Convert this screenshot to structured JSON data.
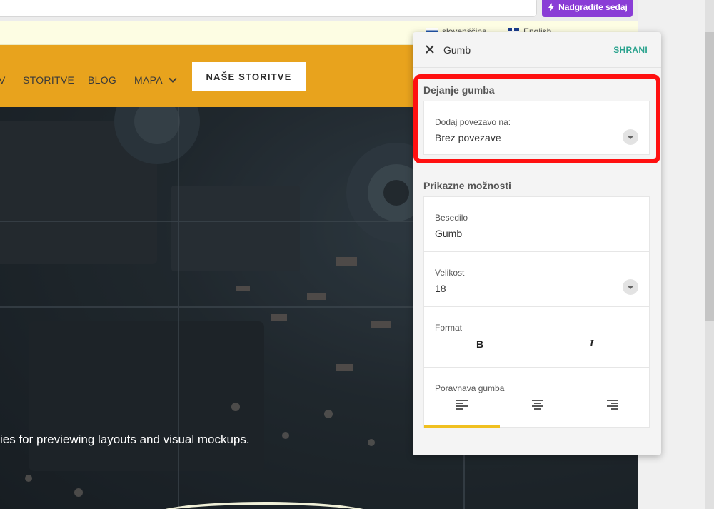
{
  "topbar": {
    "upgrade_label": "Nadgradite sedaj"
  },
  "languages": [
    {
      "label": "slovenščina"
    },
    {
      "label": "English"
    }
  ],
  "site": {
    "nav": [
      {
        "label": "V"
      },
      {
        "label": "STORITVE"
      },
      {
        "label": "BLOG"
      },
      {
        "label": "MAPA"
      }
    ],
    "cta_label": "NAŠE STORITVE",
    "hero_text": "ies for previewing layouts and visual mockups."
  },
  "panel": {
    "title": "Gumb",
    "save_label": "SHRANI",
    "action_section": {
      "label": "Dejanje gumba",
      "link_label": "Dodaj povezavo na:",
      "link_value": "Brez povezave"
    },
    "display_section": {
      "label": "Prikazne možnosti",
      "text_label": "Besedilo",
      "text_value": "Gumb",
      "size_label": "Velikost",
      "size_value": "18",
      "format_label": "Format",
      "bold_label": "B",
      "italic_label": "I",
      "alignment_label": "Poravnava gumba",
      "alignment_selected": "left"
    }
  },
  "colors": {
    "header": "#e8a31d",
    "save": "#2ba38e",
    "upgrade": "#8a3dd6",
    "highlight": "#ff1010",
    "align_active": "#f0c020"
  }
}
